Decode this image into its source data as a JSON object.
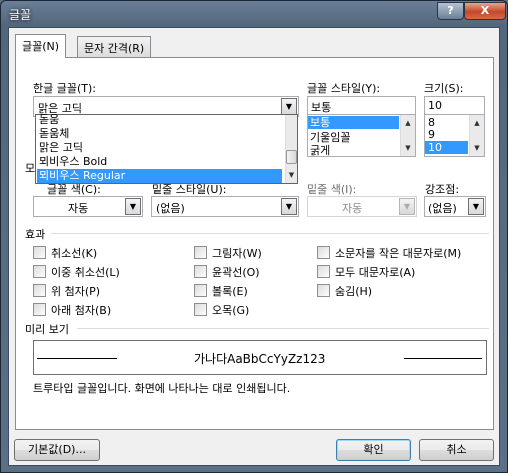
{
  "window": {
    "title": "글꼴",
    "help_glyph": "?",
    "close_glyph": "X"
  },
  "tabs": [
    {
      "label": "글꼴(N)"
    },
    {
      "label": "문자 간격(R)"
    }
  ],
  "font": {
    "label": "한글 글꼴(T):",
    "value": "맑은 고딕",
    "dropdown_items": [
      "돋움",
      "돋움체",
      "맑은 고딕",
      "뫼비우스 Bold",
      "뫼비우스 Regular"
    ],
    "selected_item": "뫼비우스 Regular"
  },
  "style": {
    "label": "글꼴 스타일(Y):",
    "value": "보통",
    "items": [
      "보통",
      "기울임꼴",
      "굵게"
    ],
    "selected_item": "보통"
  },
  "size": {
    "label": "크기(S):",
    "value": "10",
    "items": [
      "8",
      "9",
      "10"
    ],
    "selected_item": "10"
  },
  "row2": {
    "color_label": "글꼴 색(C):",
    "color_value": "자동",
    "underline_style_label": "밑줄 스타일(U):",
    "underline_style_value": "(없음)",
    "underline_color_label": "밑줄 색(I):",
    "underline_color_value": "자동",
    "emphasis_label": "강조점:",
    "emphasis_value": "(없음)",
    "hidden_fragment": "모"
  },
  "effects": {
    "label": "효과",
    "items": [
      {
        "label": "취소선(K)",
        "checked": false
      },
      {
        "label": "이중 취소선(L)",
        "checked": false
      },
      {
        "label": "위 첨자(P)",
        "checked": false
      },
      {
        "label": "아래 첨자(B)",
        "checked": false
      },
      {
        "label": "그림자(W)",
        "checked": false
      },
      {
        "label": "윤곽선(O)",
        "checked": false
      },
      {
        "label": "볼록(E)",
        "checked": false
      },
      {
        "label": "오목(G)",
        "checked": false
      },
      {
        "label": "소문자를 작은 대문자로(M)",
        "checked": false
      },
      {
        "label": "모두 대문자로(A)",
        "checked": false
      },
      {
        "label": "숨김(H)",
        "checked": false
      }
    ]
  },
  "preview": {
    "label": "미리 보기",
    "sample": "가나다AaBbCcYyZz123",
    "description": "트루타입 글꼴입니다. 화면에 나타나는 대로 인쇄됩니다."
  },
  "buttons": {
    "default_label": "기본값(D)...",
    "ok_label": "확인",
    "cancel_label": "취소"
  },
  "icons": {
    "dropdown_arrow": "▼",
    "scroll_up": "▲",
    "scroll_down": "▼"
  }
}
